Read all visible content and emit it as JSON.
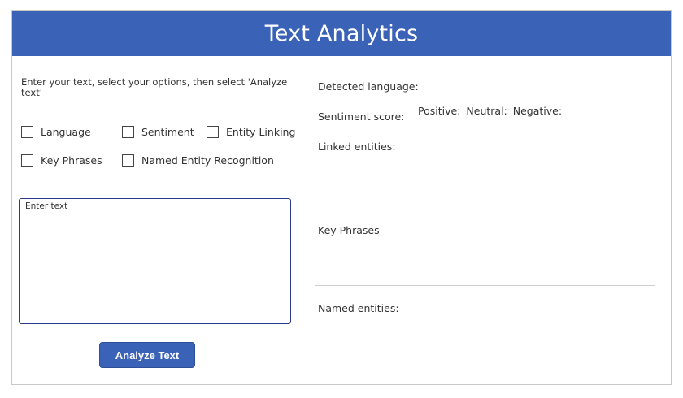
{
  "header": {
    "title": "Text Analytics"
  },
  "input_panel": {
    "instructions": "Enter your text, select your options, then select 'Analyze text'",
    "options": {
      "language": "Language",
      "sentiment": "Sentiment",
      "entity_linking": "Entity Linking",
      "key_phrases": "Key Phrases",
      "named_entity_recognition": "Named Entity Recognition"
    },
    "textbox_placeholder": "Enter text",
    "analyze_button": "Analyze Text"
  },
  "results_panel": {
    "detected_language": "Detected language:",
    "sentiment_score": "Sentiment score:",
    "positive": "Positive:",
    "neutral": "Neutral:",
    "negative": "Negative:",
    "linked_entities": "Linked entities:",
    "key_phrases": "Key Phrases",
    "named_entities": "Named entities:"
  },
  "colors": {
    "accent": "#3a62b6",
    "textbox_border": "#2b3a8c"
  }
}
